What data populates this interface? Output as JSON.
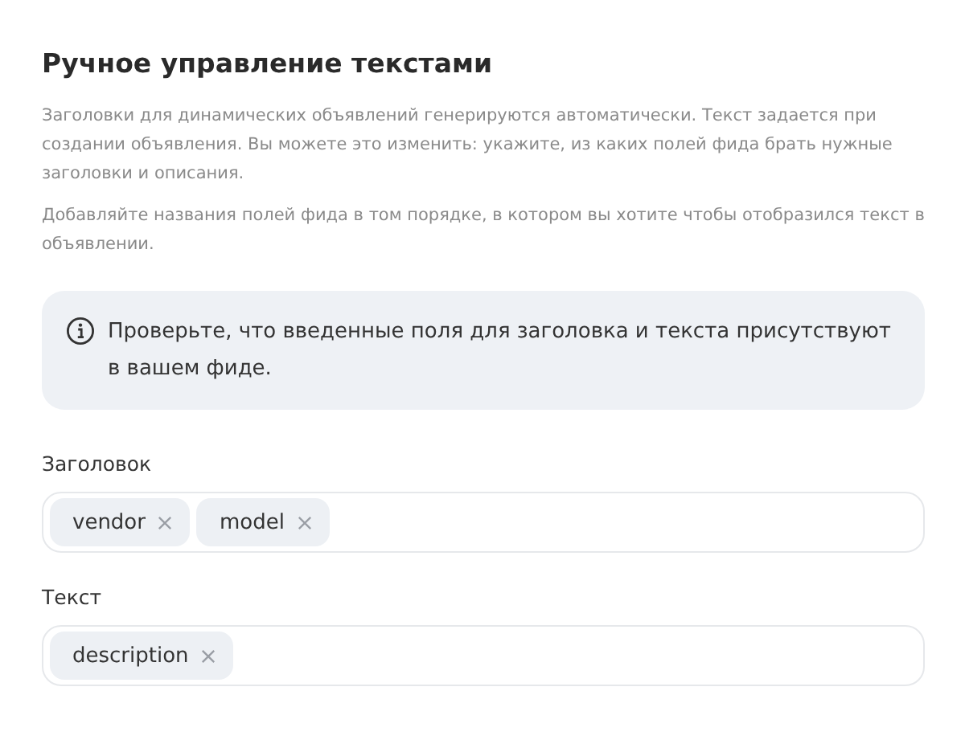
{
  "title": "Ручное управление текстами",
  "paragraphs": [
    "Заголовки для динамических объявлений генерируются автоматически. Текст задается при создании объявления. Вы можете это изменить: укажите, из каких полей фида брать нужные заголовки и описания.",
    "Добавляйте названия полей фида в том порядке, в котором вы хотите чтобы отобразился текст в объявлении."
  ],
  "notice": "Проверьте, что введенные поля для заголовка и текста присутствуют в вашем фиде.",
  "fields": [
    {
      "label": "Заголовок",
      "tags": [
        "vendor",
        "model"
      ]
    },
    {
      "label": "Текст",
      "tags": [
        "description"
      ]
    }
  ]
}
